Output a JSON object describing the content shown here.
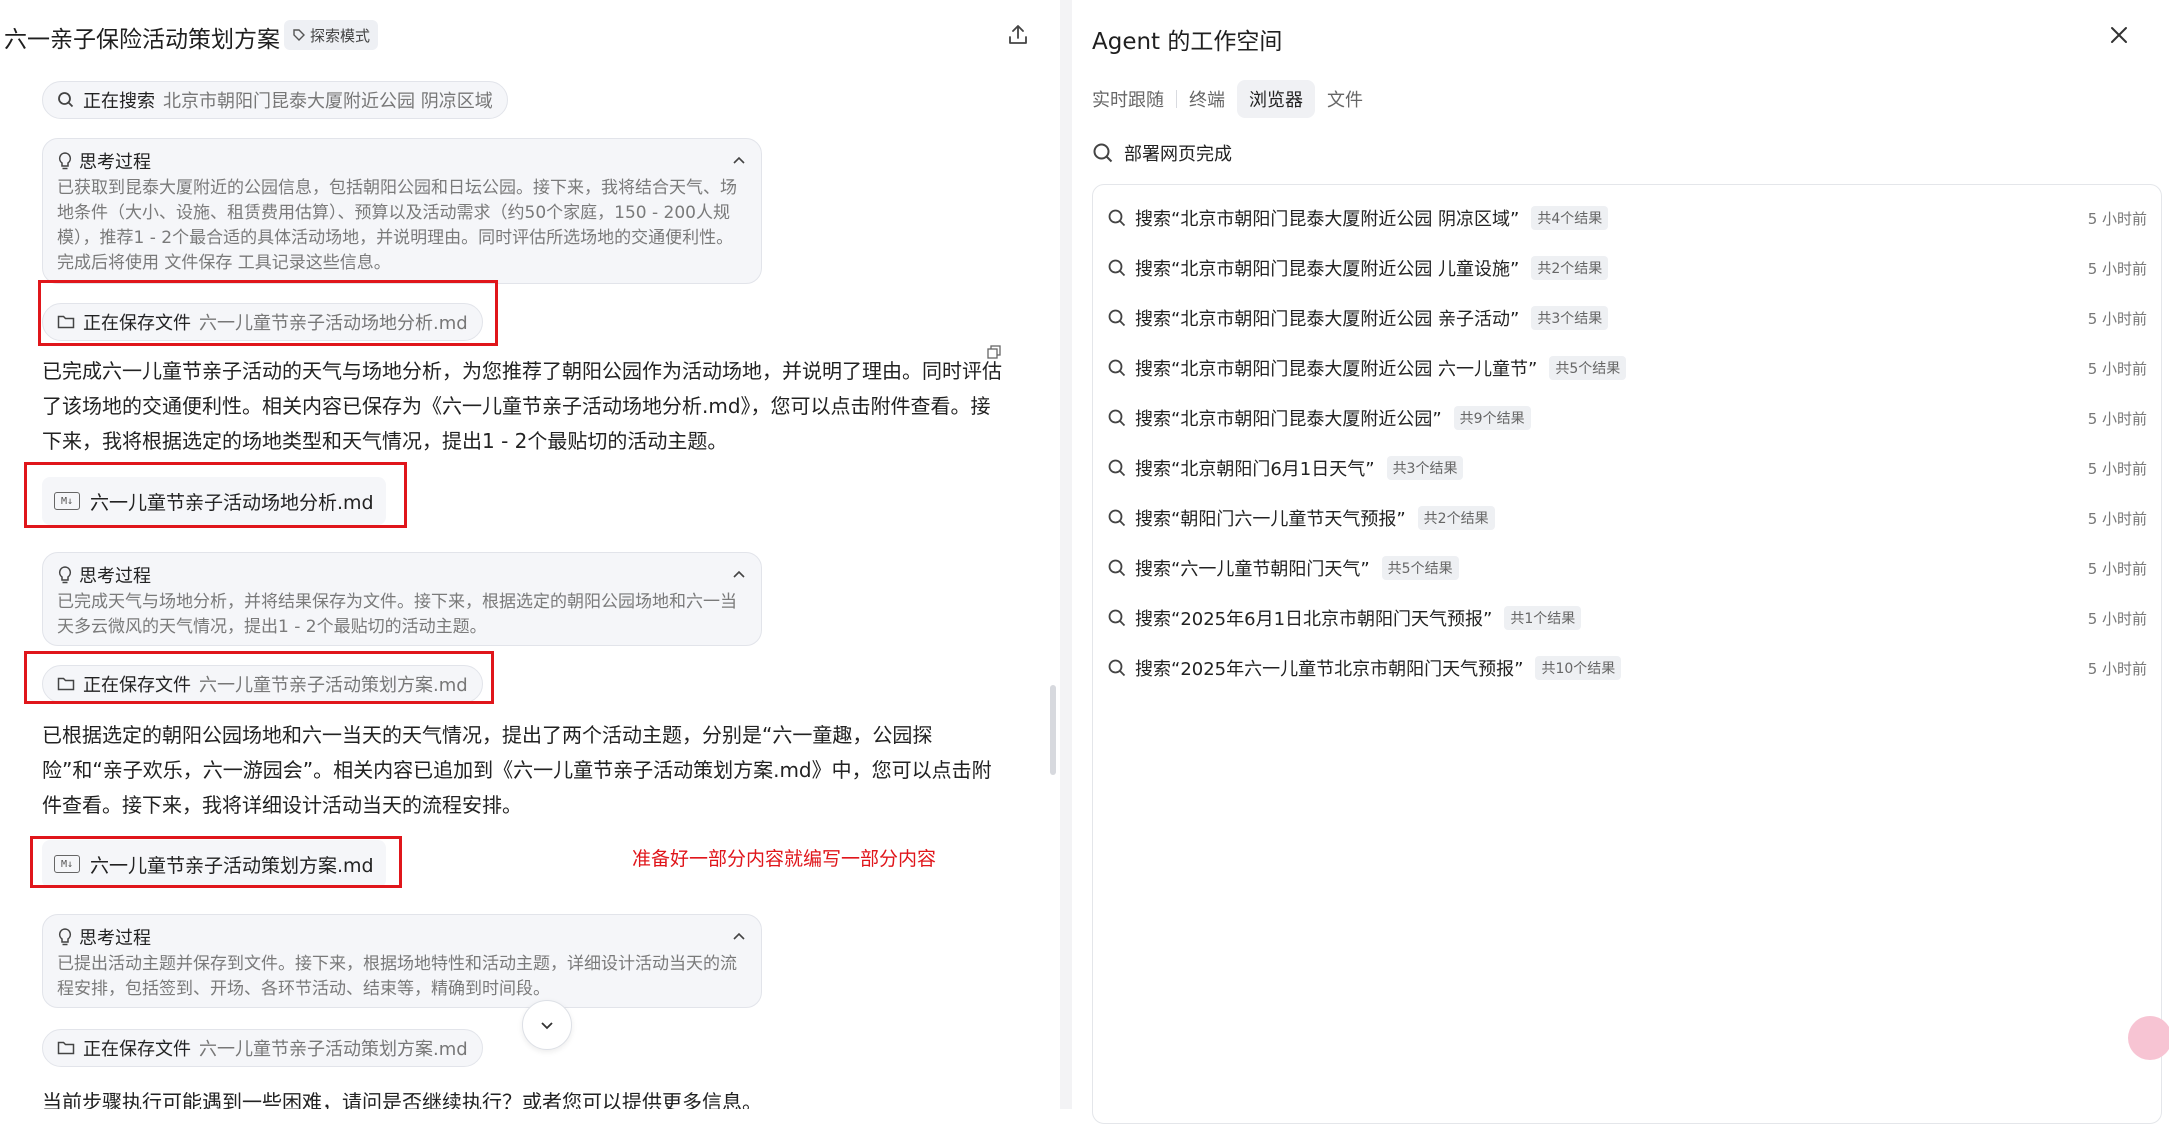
{
  "left": {
    "title": "六一亲子保险活动策划方案",
    "mode_badge": "探索模式",
    "search_pill": {
      "label": "正在搜索",
      "value": "北京市朝阳门昆泰大厦附近公园 阴凉区域"
    },
    "think1": {
      "title": "思考过程",
      "body": "已获取到昆泰大厦附近的公园信息，包括朝阳公园和日坛公园。接下来，我将结合天气、场地条件（大小、设施、租赁费用估算）、预算以及活动需求（约50个家庭，150 - 200人规模），推荐1 - 2个最合适的具体活动场地，并说明理由。同时评估所选场地的交通便利性。完成后将使用 文件保存 工具记录这些信息。"
    },
    "save1": {
      "label": "正在保存文件",
      "value": "六一儿童节亲子活动场地分析.md"
    },
    "para1": "已完成六一儿童节亲子活动的天气与场地分析，为您推荐了朝阳公园作为活动场地，并说明了理由。同时评估了该场地的交通便利性。相关内容已保存为《六一儿童节亲子活动场地分析.md》，您可以点击附件查看。接下来，我将根据选定的场地类型和天气情况，提出1 - 2个最贴切的活动主题。",
    "file1": "六一儿童节亲子活动场地分析.md",
    "think2": {
      "title": "思考过程",
      "body": "已完成天气与场地分析，并将结果保存为文件。接下来，根据选定的朝阳公园场地和六一当天多云微风的天气情况，提出1 - 2个最贴切的活动主题。"
    },
    "save2": {
      "label": "正在保存文件",
      "value": "六一儿童节亲子活动策划方案.md"
    },
    "para2": "已根据选定的朝阳公园场地和六一当天的天气情况，提出了两个活动主题，分别是“六一童趣，公园探险”和“亲子欢乐，六一游园会”。相关内容已追加到《六一儿童节亲子活动策划方案.md》中，您可以点击附件查看。接下来，我将详细设计活动当天的流程安排。",
    "file2": "六一儿童节亲子活动策划方案.md",
    "annotation": "准备好一部分内容就编写一部分内容",
    "think3": {
      "title": "思考过程",
      "body": "已提出活动主题并保存到文件。接下来，根据场地特性和活动主题，详细设计活动当天的流程安排，包括签到、开场、各环节活动、结束等，精确到时间段。"
    },
    "save3": {
      "label": "正在保存文件",
      "value": "六一儿童节亲子活动策划方案.md"
    },
    "cut_text": "当前步骤执行可能遇到一些困难，请问是否继续执行？或者您可以提供更多信息。"
  },
  "right": {
    "title": "Agent 的工作空间",
    "tabs": [
      "实时跟随",
      "终端",
      "浏览器",
      "文件"
    ],
    "active_tab": "浏览器",
    "status": "部署网页完成",
    "results": [
      {
        "query": "搜索“北京市朝阳门昆泰大厦附近公园 阴凉区域”",
        "count": "共4个结果",
        "time": "5 小时前"
      },
      {
        "query": "搜索“北京市朝阳门昆泰大厦附近公园 儿童设施”",
        "count": "共2个结果",
        "time": "5 小时前"
      },
      {
        "query": "搜索“北京市朝阳门昆泰大厦附近公园 亲子活动”",
        "count": "共3个结果",
        "time": "5 小时前"
      },
      {
        "query": "搜索“北京市朝阳门昆泰大厦附近公园 六一儿童节”",
        "count": "共5个结果",
        "time": "5 小时前"
      },
      {
        "query": "搜索“北京市朝阳门昆泰大厦附近公园”",
        "count": "共9个结果",
        "time": "5 小时前"
      },
      {
        "query": "搜索“北京朝阳门6月1日天气”",
        "count": "共3个结果",
        "time": "5 小时前"
      },
      {
        "query": "搜索“朝阳门六一儿童节天气预报”",
        "count": "共2个结果",
        "time": "5 小时前"
      },
      {
        "query": "搜索“六一儿童节朝阳门天气”",
        "count": "共5个结果",
        "time": "5 小时前"
      },
      {
        "query": "搜索“2025年6月1日北京市朝阳门天气预报”",
        "count": "共1个结果",
        "time": "5 小时前"
      },
      {
        "query": "搜索“2025年六一儿童节北京市朝阳门天气预报”",
        "count": "共10个结果",
        "time": "5 小时前"
      }
    ]
  },
  "colors": {
    "highlight_red": "#e0161b",
    "pill_bg": "#f5f6f9",
    "muted_text": "#7a7a7a"
  },
  "icons": [
    "share-icon",
    "close-icon",
    "search-icon",
    "bulb-icon",
    "chevron-up-icon",
    "folder-icon",
    "markdown-file-icon",
    "chevron-down-icon",
    "copy-icon",
    "translate-icon"
  ]
}
